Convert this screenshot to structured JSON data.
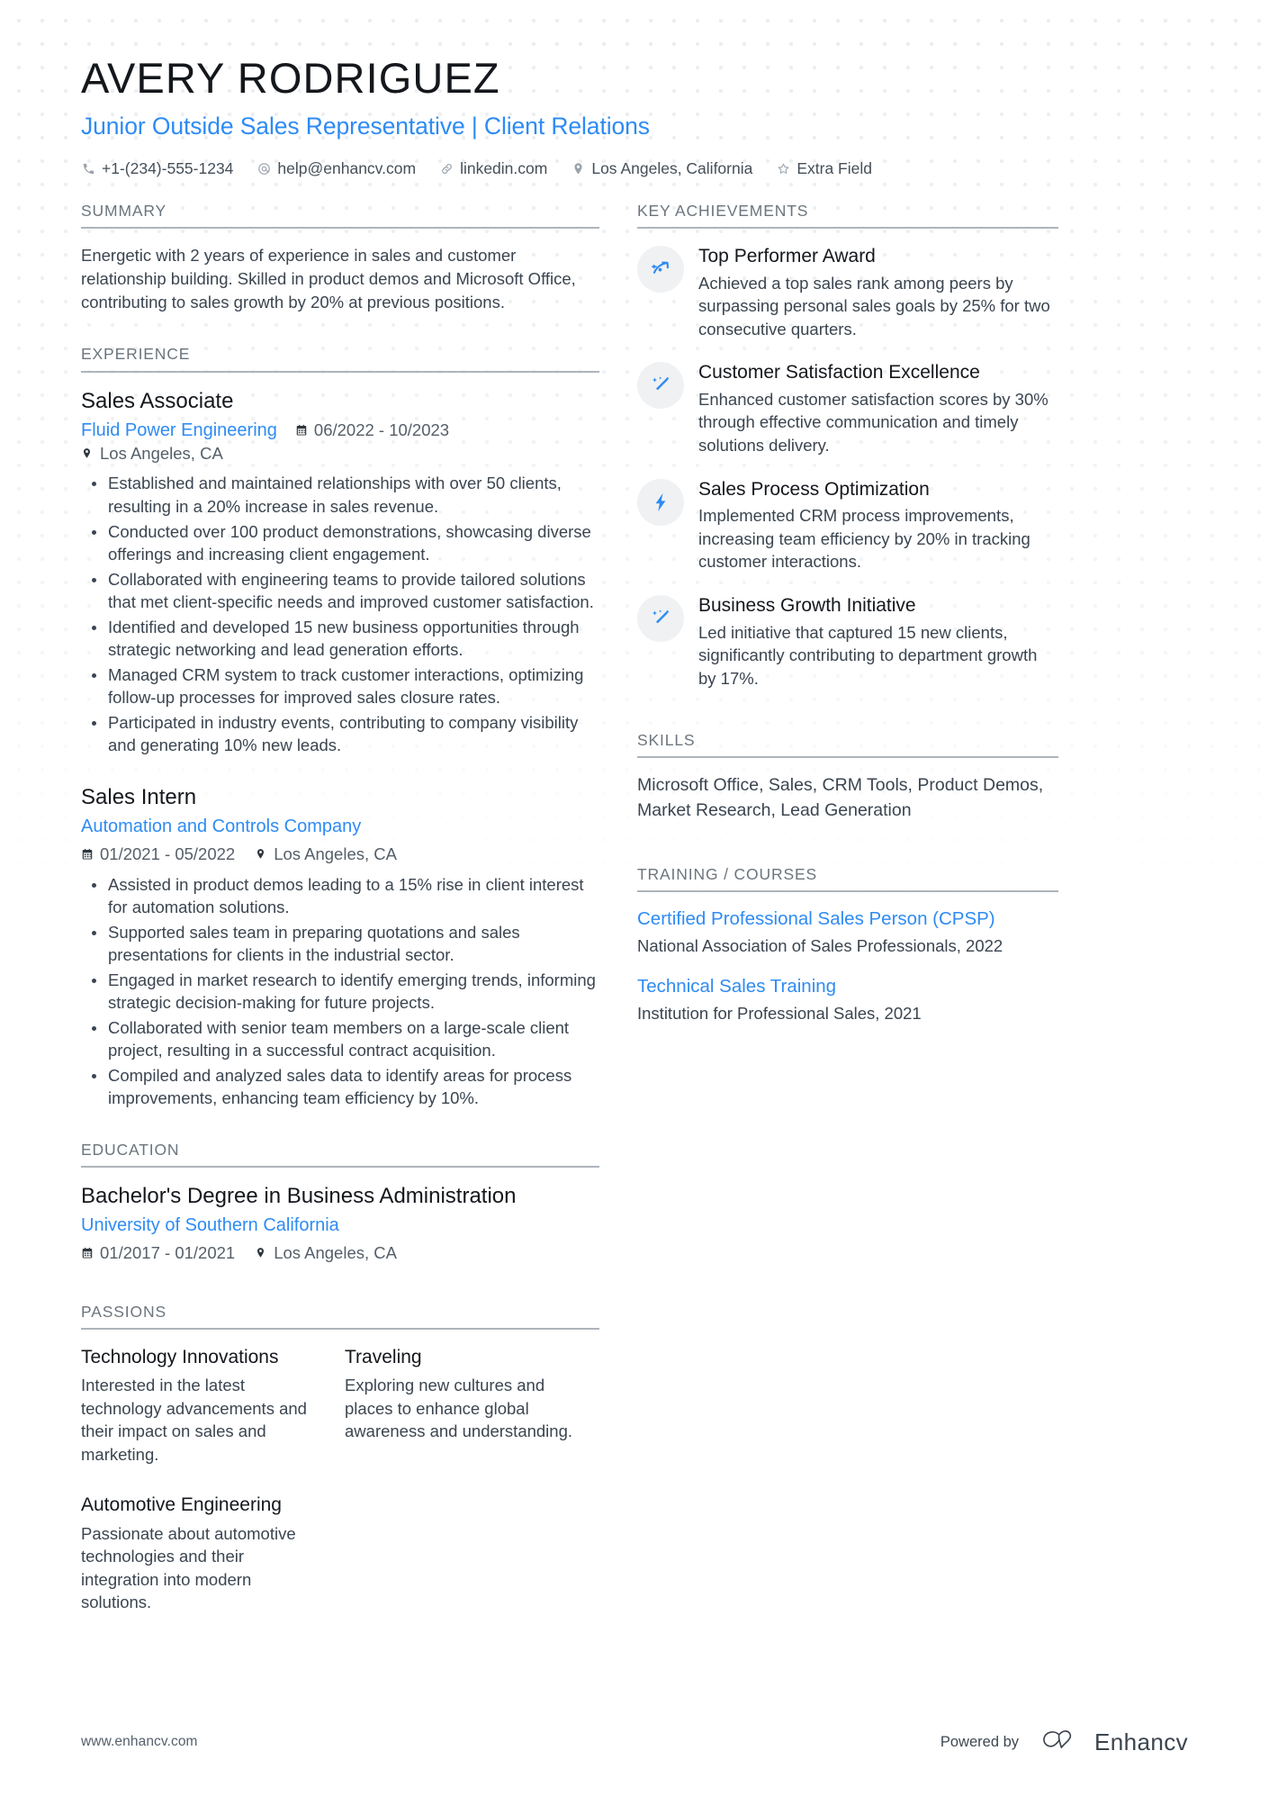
{
  "header": {
    "name": "AVERY RODRIGUEZ",
    "headline": "Junior Outside Sales Representative | Client Relations",
    "contacts": [
      {
        "icon": "phone-icon",
        "text": "+1-(234)-555-1234"
      },
      {
        "icon": "email-icon",
        "text": "help@enhancv.com"
      },
      {
        "icon": "link-icon",
        "text": "linkedin.com"
      },
      {
        "icon": "location-icon",
        "text": "Los Angeles, California"
      },
      {
        "icon": "star-icon",
        "text": "Extra Field"
      }
    ]
  },
  "left": {
    "summary": {
      "title": "SUMMARY",
      "text": "Energetic with 2 years of experience in sales and customer relationship building. Skilled in product demos and Microsoft Office, contributing to sales growth by 20% at previous positions."
    },
    "experience": {
      "title": "EXPERIENCE",
      "entries": [
        {
          "role": "Sales Associate",
          "company": "Fluid Power Engineering",
          "dates": "06/2022 - 10/2023",
          "location": "Los Angeles, CA",
          "layout": "inline",
          "bullets": [
            "Established and maintained relationships with over 50 clients, resulting in a 20% increase in sales revenue.",
            "Conducted over 100 product demonstrations, showcasing diverse offerings and increasing client engagement.",
            "Collaborated with engineering teams to provide tailored solutions that met client-specific needs and improved customer satisfaction.",
            "Identified and developed 15 new business opportunities through strategic networking and lead generation efforts.",
            "Managed CRM system to track customer interactions, optimizing follow-up processes for improved sales closure rates.",
            "Participated in industry events, contributing to company visibility and generating 10% new leads."
          ]
        },
        {
          "role": "Sales Intern",
          "company": "Automation and Controls Company",
          "dates": "01/2021 - 05/2022",
          "location": "Los Angeles, CA",
          "layout": "stacked",
          "bullets": [
            "Assisted in product demos leading to a 15% rise in client interest for automation solutions.",
            "Supported sales team in preparing quotations and sales presentations for clients in the industrial sector.",
            "Engaged in market research to identify emerging trends, informing strategic decision-making for future projects.",
            "Collaborated with senior team members on a large-scale client project, resulting in a successful contract acquisition.",
            "Compiled and analyzed sales data to identify areas for process improvements, enhancing team efficiency by 10%."
          ]
        }
      ]
    },
    "education": {
      "title": "EDUCATION",
      "entries": [
        {
          "degree": "Bachelor's Degree in Business Administration",
          "school": "University of Southern California",
          "dates": "01/2017 - 01/2021",
          "location": "Los Angeles, CA"
        }
      ]
    },
    "passions": {
      "title": "PASSIONS",
      "items": [
        {
          "name": "Technology Innovations",
          "description": "Interested in the latest technology advancements and their impact on sales and marketing."
        },
        {
          "name": "Traveling",
          "description": "Exploring new cultures and places to enhance global awareness and understanding."
        },
        {
          "name": "Automotive Engineering",
          "description": "Passionate about automotive technologies and their integration into modern solutions."
        }
      ]
    }
  },
  "right": {
    "achievements": {
      "title": "KEY ACHIEVEMENTS",
      "items": [
        {
          "icon": "trending-arrow-icon",
          "title": "Top Performer Award",
          "description": "Achieved a top sales rank among peers by surpassing personal sales goals by 25% for two consecutive quarters."
        },
        {
          "icon": "magic-wand-icon",
          "title": "Customer Satisfaction Excellence",
          "description": "Enhanced customer satisfaction scores by 30% through effective communication and timely solutions delivery."
        },
        {
          "icon": "lightning-bolt-icon",
          "title": "Sales Process Optimization",
          "description": "Implemented CRM process improvements, increasing team efficiency by 20% in tracking customer interactions."
        },
        {
          "icon": "magic-wand-icon",
          "title": "Business Growth Initiative",
          "description": "Led initiative that captured 15 new clients, significantly contributing to department growth by 17%."
        }
      ]
    },
    "skills": {
      "title": "SKILLS",
      "text": "Microsoft Office, Sales, CRM Tools, Product Demos, Market Research, Lead Generation"
    },
    "training": {
      "title": "TRAINING / COURSES",
      "items": [
        {
          "name": "Certified Professional Sales Person (CPSP)",
          "detail": "National Association of Sales Professionals, 2022"
        },
        {
          "name": "Technical Sales Training",
          "detail": "Institution for Professional Sales, 2021"
        }
      ]
    }
  },
  "footer": {
    "url": "www.enhancv.com",
    "powered_by": "Powered by",
    "brand": "Enhancv"
  },
  "colors": {
    "accent": "#2e8bf4",
    "heading": "#14171c",
    "body": "#3b4550",
    "section_label": "#6c757d",
    "rule": "#aeb4ba",
    "icon_bubble": "#f0f1f2"
  }
}
